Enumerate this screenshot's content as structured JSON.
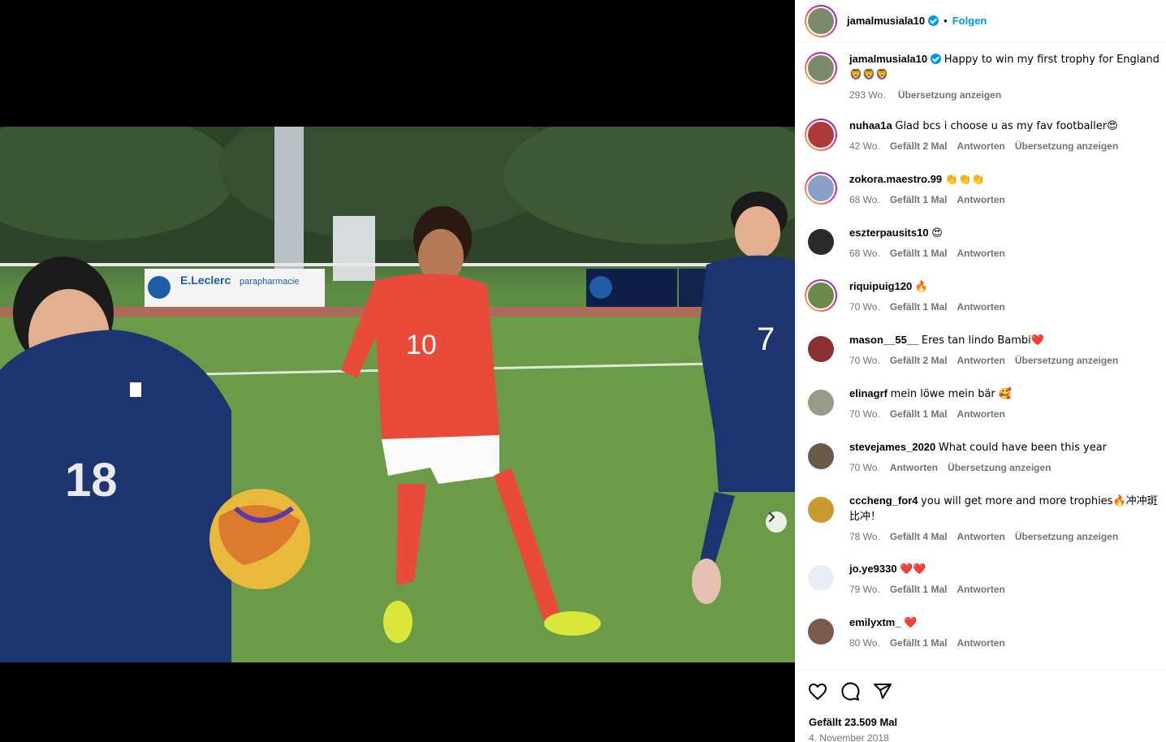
{
  "header": {
    "username": "jamalmusiala10",
    "separator": "•",
    "follow_label": "Folgen"
  },
  "caption": {
    "username": "jamalmusiala10",
    "text": "Happy to win my first trophy for England 🦁🦁🦁",
    "time": "293 Wo.",
    "translate": "Übersetzung anzeigen"
  },
  "comments": [
    {
      "user": "nuhaa1a",
      "text": "Glad bcs i choose u as my fav footballer😍",
      "time": "42 Wo.",
      "likes": "Gefällt 2 Mal",
      "reply": "Antworten",
      "translate": "Übersetzung anzeigen",
      "avatar_color": "#b03a3a",
      "ring": true
    },
    {
      "user": "zokora.maestro.99",
      "text": "👏👏👏",
      "time": "68 Wo.",
      "likes": "Gefällt 1 Mal",
      "reply": "Antworten",
      "translate": "",
      "avatar_color": "#8aa0c8",
      "ring": true
    },
    {
      "user": "eszterpausits10",
      "text": "😍",
      "time": "68 Wo.",
      "likes": "Gefällt 1 Mal",
      "reply": "Antworten",
      "translate": "",
      "avatar_color": "#2a2a2a",
      "ring": false
    },
    {
      "user": "riquipuig120",
      "text": "🔥",
      "time": "70 Wo.",
      "likes": "Gefällt 1 Mal",
      "reply": "Antworten",
      "translate": "",
      "avatar_color": "#6a8a4a",
      "ring": true
    },
    {
      "user": "mason__55__",
      "text": "Eres tan lindo Bambi❤️",
      "time": "70 Wo.",
      "likes": "Gefällt 2 Mal",
      "reply": "Antworten",
      "translate": "Übersetzung anzeigen",
      "avatar_color": "#8a3030",
      "ring": false
    },
    {
      "user": "elinagrf",
      "text": "mein löwe mein bär 🥰",
      "time": "70 Wo.",
      "likes": "Gefällt 1 Mal",
      "reply": "Antworten",
      "translate": "",
      "avatar_color": "#9a9a8a",
      "ring": false
    },
    {
      "user": "stevejames_2020",
      "text": "What could have been this year",
      "time": "70 Wo.",
      "likes": "",
      "reply": "Antworten",
      "translate": "Übersetzung anzeigen",
      "avatar_color": "#6a5a4a",
      "ring": false
    },
    {
      "user": "cccheng_for4",
      "text": "you will get more and more trophies🔥冲冲斑比冲！",
      "time": "78 Wo.",
      "likes": "Gefällt 4 Mal",
      "reply": "Antworten",
      "translate": "Übersetzung anzeigen",
      "avatar_color": "#c89a30",
      "ring": false
    },
    {
      "user": "jo.ye9330",
      "text": "❤️❤️",
      "time": "79 Wo.",
      "likes": "Gefällt 1 Mal",
      "reply": "Antworten",
      "translate": "",
      "avatar_color": "#e8eef8",
      "ring": false
    },
    {
      "user": "emilyxtm_",
      "text": "❤️",
      "time": "80 Wo.",
      "likes": "Gefällt 1 Mal",
      "reply": "Antworten",
      "translate": "",
      "avatar_color": "#7a5a4a",
      "ring": false
    }
  ],
  "footer": {
    "likes": "Gefällt 23.509 Mal",
    "date": "4. November 2018"
  },
  "icons": {
    "like": "heart-icon",
    "comment": "comment-icon",
    "share": "share-icon",
    "next": "chevron-right-icon",
    "verified": "verified-badge-icon"
  },
  "photo_text": {
    "banner_brand": "E.Leclerc",
    "banner_sub": "parapharmacie",
    "jersey_england": "10",
    "jersey_japan_left": "18",
    "jersey_japan_right": "7"
  }
}
